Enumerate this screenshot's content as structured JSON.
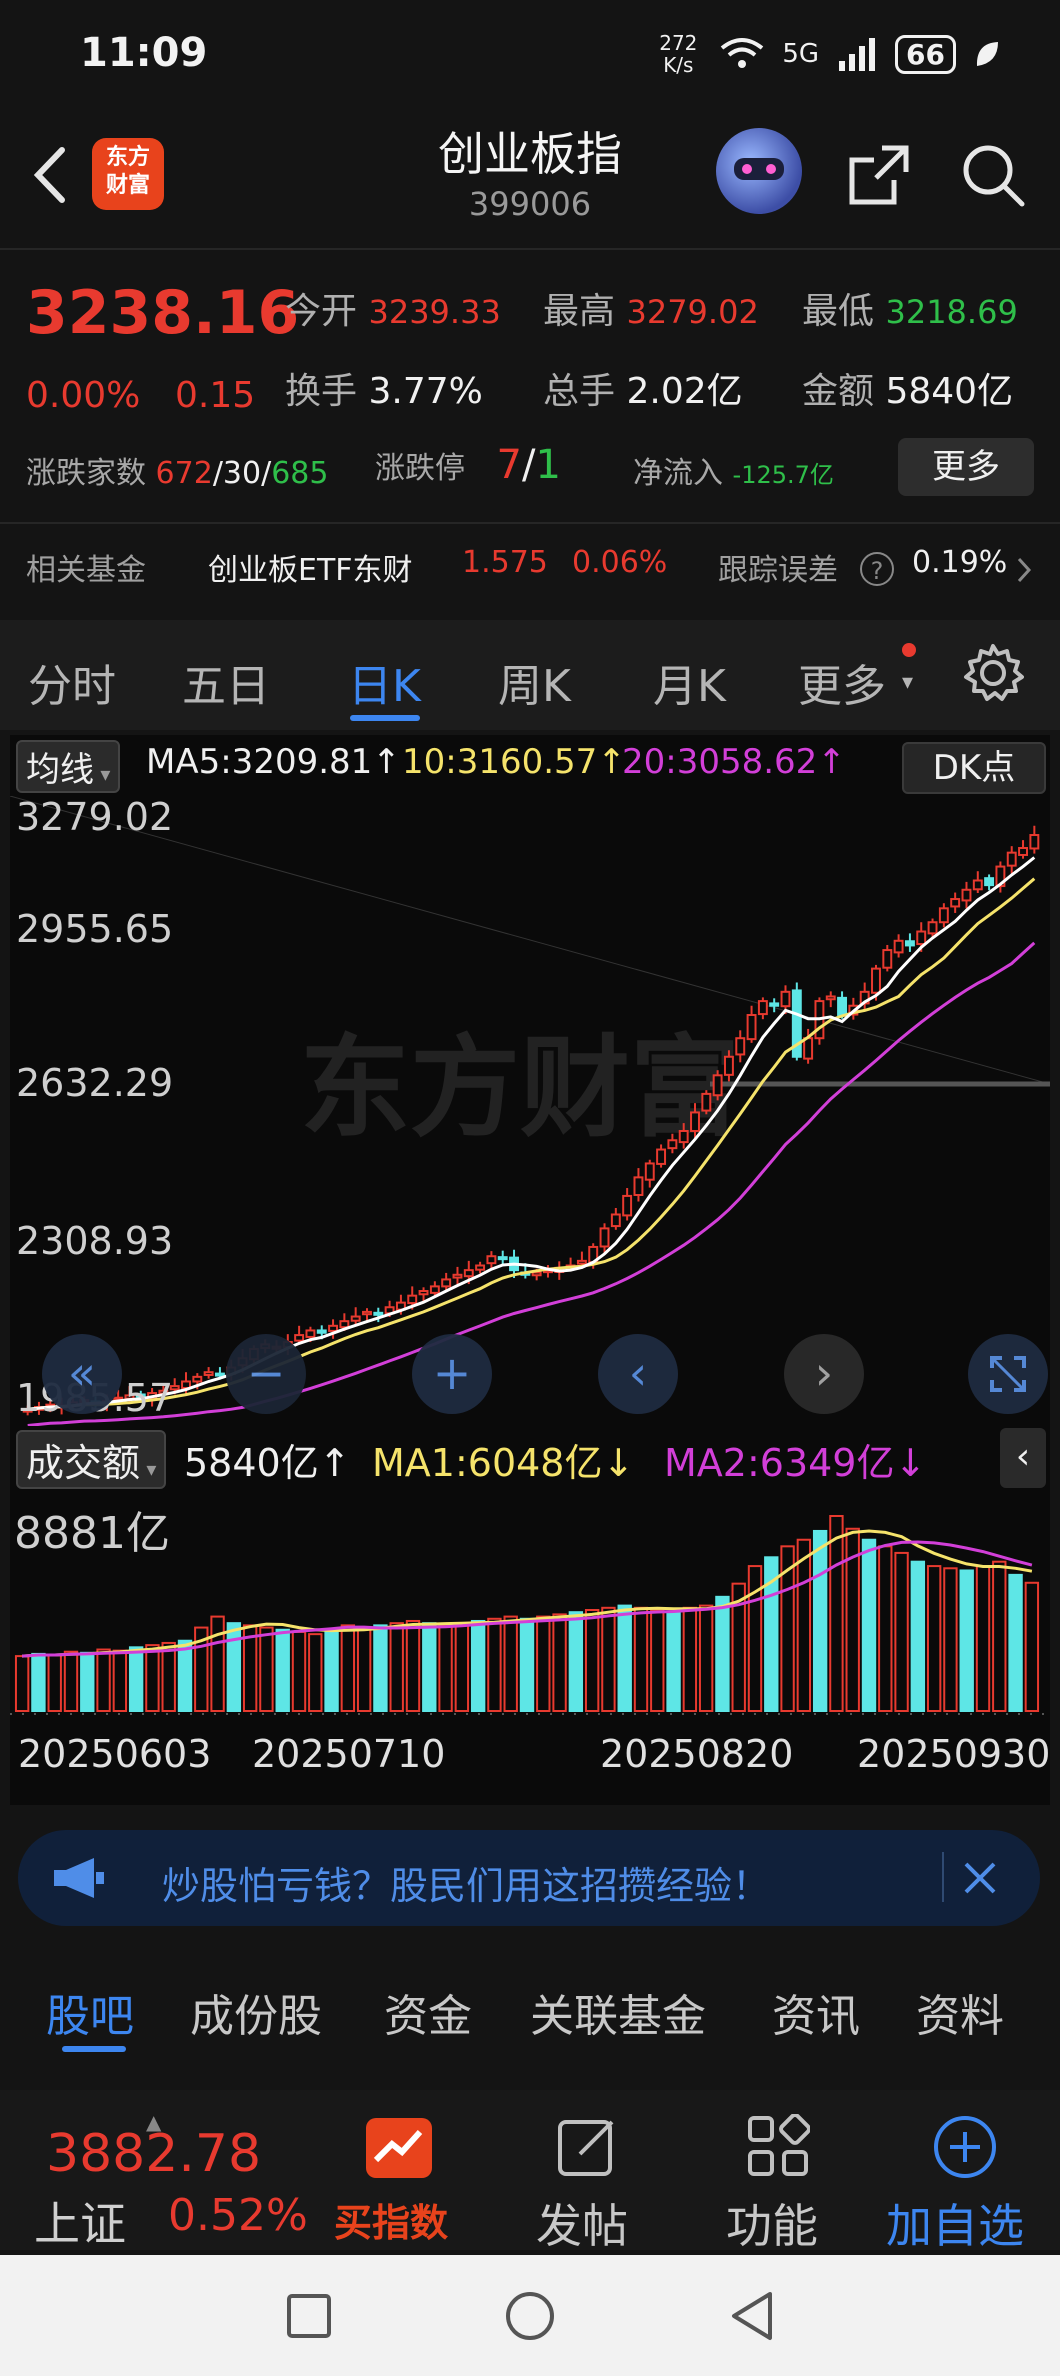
{
  "status_bar": {
    "time": "11:09",
    "net_speed": "272 K/s",
    "signal": "5G",
    "battery": "66"
  },
  "header": {
    "title": "创业板指",
    "code": "399006",
    "logo_text": "东方财富"
  },
  "quote": {
    "price": "3238.16",
    "change_pct": "0.00%",
    "change": "0.15",
    "open_label": "今开",
    "open": "3239.33",
    "high_label": "最高",
    "high": "3279.02",
    "low_label": "最低",
    "low": "3218.69",
    "turnover_label": "换手",
    "turnover": "3.77%",
    "volume_label": "总手",
    "volume": "2.02亿",
    "amount_label": "金额",
    "amount": "5840亿",
    "breadth_label": "涨跌家数",
    "up_count": "672",
    "flat_count": "30",
    "down_count": "685",
    "limit_label": "涨跌停",
    "limit_up": "7",
    "limit_down": "1",
    "netflow_label": "净流入",
    "netflow": "-125.7亿",
    "more_label": "更多"
  },
  "fund": {
    "label": "相关基金",
    "name": "创业板ETF东财",
    "price": "1.575",
    "pct": "0.06%",
    "track_label": "跟踪误差",
    "track_value": "0.19%"
  },
  "tabs": [
    "分时",
    "五日",
    "日K",
    "周K",
    "月K",
    "更多"
  ],
  "active_tab": "日K",
  "ma_bar": {
    "type": "均线",
    "ma5": "MA5:3209.81↑",
    "ma10": "10:3160.57↑",
    "ma20": "20:3058.62↑",
    "dk": "DK点"
  },
  "price_axis": [
    "3279.02",
    "2955.65",
    "2632.29",
    "2308.93",
    "1985.57"
  ],
  "watermark": "东方财富",
  "vol_bar": {
    "type": "成交额",
    "value": "5840亿↑",
    "ma1": "MA1:6048亿↓",
    "ma2": "MA2:6349亿↓",
    "axis_max": "8881亿"
  },
  "dates": [
    "20250603",
    "20250710",
    "20250820",
    "20250930"
  ],
  "ad": {
    "text": "炒股怕亏钱？股民们用这招攒经验！"
  },
  "bottom_tabs": [
    "股吧",
    "成份股",
    "资金",
    "关联基金",
    "资讯",
    "资料"
  ],
  "bottom_nav": {
    "index_price": "3882.78",
    "index_name": "上证",
    "index_pct": "0.52%",
    "buy": "买指数",
    "post": "发帖",
    "func": "功能",
    "add": "加自选"
  },
  "colors": {
    "up": "#e83a2f",
    "down": "#5ee6e6",
    "ma5": "#ffffff",
    "ma10": "#f5e36b",
    "ma20": "#d23fd8",
    "accent": "#3d86f0"
  },
  "chart_data": {
    "type": "candlestick",
    "x_start": "20250603",
    "x_end": "20250930",
    "ylim": [
      1985.57,
      3279.02
    ],
    "close": [
      2000,
      2005,
      2010,
      2008,
      2015,
      2020,
      2012,
      2018,
      2025,
      2030,
      2028,
      2035,
      2040,
      2050,
      2060,
      2070,
      2080,
      2075,
      2090,
      2110,
      2130,
      2140,
      2135,
      2145,
      2160,
      2170,
      2165,
      2180,
      2190,
      2200,
      2210,
      2205,
      2220,
      2230,
      2245,
      2255,
      2265,
      2280,
      2290,
      2300,
      2310,
      2330,
      2325,
      2300,
      2290,
      2295,
      2300,
      2305,
      2310,
      2320,
      2350,
      2390,
      2420,
      2460,
      2500,
      2530,
      2560,
      2580,
      2600,
      2640,
      2680,
      2720,
      2760,
      2800,
      2850,
      2880,
      2870,
      2900,
      2760,
      2800,
      2880,
      2890,
      2850,
      2870,
      2900,
      2950,
      2990,
      3010,
      3000,
      3030,
      3050,
      3080,
      3100,
      3120,
      3140,
      3130,
      3170,
      3200,
      3210,
      3238
    ],
    "volume_yi": [
      2500,
      2600,
      2550,
      2700,
      2650,
      2800,
      2750,
      2900,
      3000,
      3100,
      3200,
      3800,
      4300,
      4000,
      3900,
      3800,
      3700,
      3600,
      3500,
      3700,
      3900,
      3800,
      3900,
      4000,
      4100,
      4000,
      3900,
      4000,
      4100,
      4200,
      4300,
      4200,
      4300,
      4400,
      4500,
      4600,
      4700,
      4800,
      4700,
      4600,
      4500,
      4700,
      4800,
      5200,
      5800,
      6600,
      7000,
      7500,
      7800,
      8200,
      8881,
      8300,
      7800,
      7500,
      7200,
      6800,
      6600,
      6500,
      6400,
      6600,
      6800,
      6200,
      5840
    ],
    "ma5_last": 3209.81,
    "ma10_last": 3160.57,
    "ma20_last": 3058.62,
    "vol_ma1_last": 6048,
    "vol_ma2_last": 6349
  }
}
